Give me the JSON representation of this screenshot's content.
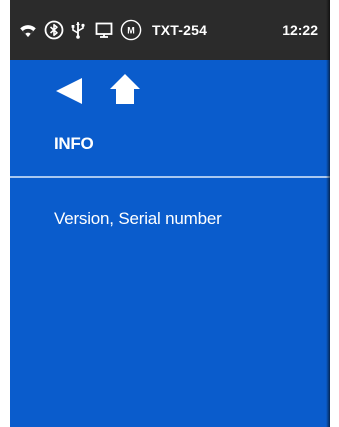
{
  "status_bar": {
    "icons": [
      "wifi-icon",
      "bluetooth-icon",
      "usb-icon",
      "display-icon",
      "m-circle-icon"
    ],
    "m_icon_label": "M",
    "device_id": "TXT-254",
    "time": "12:22"
  },
  "nav": {
    "back_icon": "back-arrow-icon",
    "home_icon": "home-icon"
  },
  "page": {
    "title": "INFO"
  },
  "menu": {
    "items": [
      {
        "label": "Version, Serial number"
      }
    ]
  },
  "colors": {
    "background": "#0a5ccc",
    "status_bar": "#2b2b2b",
    "divider": "#a8c8f0",
    "text": "#ffffff"
  }
}
